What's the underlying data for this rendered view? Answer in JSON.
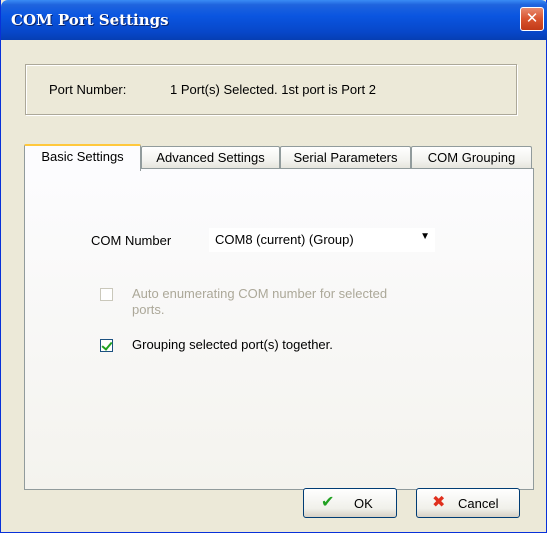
{
  "window": {
    "title": "COM Port Settings",
    "close_glyph": "✕"
  },
  "port": {
    "label": "Port Number:",
    "value": "1 Port(s) Selected. 1st port is Port 2"
  },
  "tabs": [
    {
      "label": "Basic Settings",
      "active": true
    },
    {
      "label": "Advanced Settings",
      "active": false
    },
    {
      "label": "Serial Parameters",
      "active": false
    },
    {
      "label": "COM Grouping",
      "active": false
    }
  ],
  "basic": {
    "com_number_label": "COM Number",
    "com_number_value": "COM8 (current) (Group)",
    "auto_enumerate": {
      "line1": "Auto enumerating COM number for selected",
      "line2": "ports.",
      "checked": false,
      "enabled": false
    },
    "grouping": {
      "label": "Grouping selected port(s) together.",
      "checked": true,
      "enabled": true
    }
  },
  "buttons": {
    "ok_label": "OK",
    "ok_icon": "check-icon",
    "cancel_label": "Cancel",
    "cancel_icon": "x-icon"
  },
  "colors": {
    "titlebar": "#0a55e0",
    "close_button": "#d8532e",
    "active_tab_accent": "#ffc83c",
    "ok_icon": "#21a121",
    "cancel_icon": "#e0301e"
  }
}
